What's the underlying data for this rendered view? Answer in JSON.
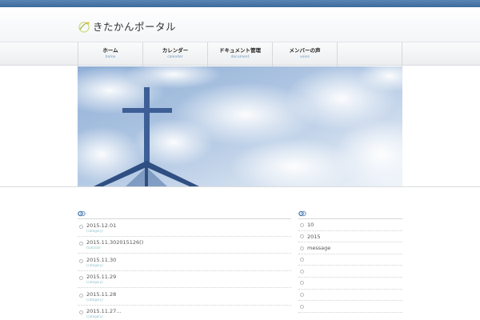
{
  "site": {
    "title": "きたかんポータル"
  },
  "nav": [
    {
      "label": "ホーム",
      "sub": "home"
    },
    {
      "label": "カレンダー",
      "sub": "calender"
    },
    {
      "label": "ドキュメント管理",
      "sub": "document"
    },
    {
      "label": "メンバーの声",
      "sub": "voice"
    },
    {
      "label": "",
      "sub": ""
    }
  ],
  "news": [
    {
      "date": "2015.12.01",
      "category": "(category)"
    },
    {
      "date": "2015.11.302015126()",
      "category": "(tutorial)"
    },
    {
      "date": "2015.11.30",
      "category": "(category)"
    },
    {
      "date": "2015.11.29",
      "category": "(category)"
    },
    {
      "date": "2015.11.28",
      "category": "(category)"
    },
    {
      "date": "2015.11.27...",
      "category": "(category)"
    }
  ],
  "sidebar": [
    {
      "label": "10"
    },
    {
      "label": "2015"
    },
    {
      "label": "message"
    },
    {
      "label": ""
    },
    {
      "label": ""
    },
    {
      "label": ""
    },
    {
      "label": ""
    },
    {
      "label": ""
    }
  ],
  "colors": {
    "topbar": "#4a78a8",
    "accent": "#6a95bd",
    "category": "#8fc2cc"
  }
}
